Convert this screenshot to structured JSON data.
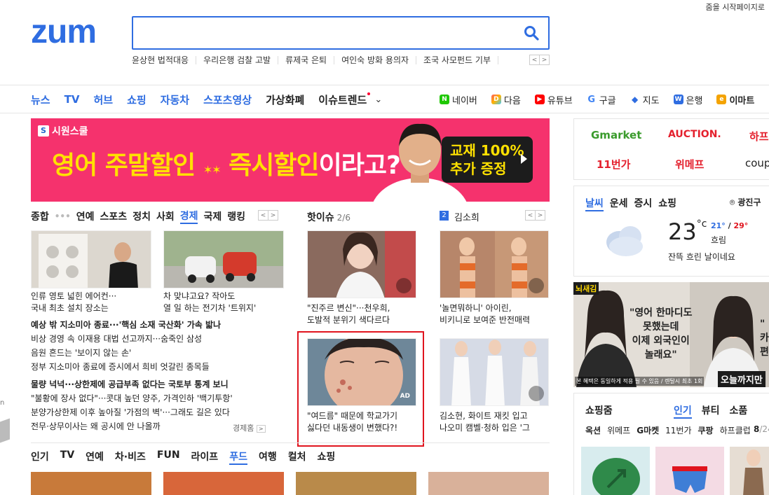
{
  "top": {
    "start_page_text": "줌을 시작페이지로"
  },
  "logo": {
    "text": "zum"
  },
  "search": {
    "value": "",
    "placeholder": ""
  },
  "trending_keywords": [
    "윤상현 법적대응",
    "우리은행 검찰 고발",
    "류제국 은퇴",
    "여인숙 방화 용의자",
    "조국 사모펀드 기부"
  ],
  "nav": {
    "items": [
      {
        "label": "뉴스",
        "style": "blue"
      },
      {
        "label": "TV",
        "style": "blue"
      },
      {
        "label": "허브",
        "style": "blue"
      },
      {
        "label": "쇼핑",
        "style": "blue"
      },
      {
        "label": "자동차",
        "style": "blue"
      },
      {
        "label": "스포츠영상",
        "style": "blue"
      },
      {
        "label": "가상화폐",
        "style": "dark"
      },
      {
        "label": "이슈트렌드",
        "style": "dark"
      }
    ],
    "shortcuts": [
      {
        "label": "네이버",
        "icon": "naver-icon",
        "color": "#1ec800",
        "glyph": "N"
      },
      {
        "label": "다음",
        "icon": "daum-icon",
        "color": "#6b8bff",
        "glyph": "D"
      },
      {
        "label": "유튜브",
        "icon": "youtube-icon",
        "color": "#ff0000",
        "glyph": "▶"
      },
      {
        "label": "구글",
        "icon": "google-icon",
        "color": "#4285f4",
        "glyph": "G"
      },
      {
        "label": "지도",
        "icon": "map-icon",
        "color": "#2f6de1",
        "glyph": "◆"
      },
      {
        "label": "은행",
        "icon": "bank-icon",
        "color": "#2f6de1",
        "glyph": "W"
      },
      {
        "label": "이마트",
        "icon": "emart-icon",
        "color": "#f4a300",
        "glyph": "e"
      }
    ]
  },
  "banner": {
    "brand": "시원스쿨",
    "headline_yellow_1": "영어 주말할인",
    "headline_mid": "즉시할인",
    "headline_white": "이라고?",
    "badge_line1": "교재 100%",
    "badge_line2": "추가 증정"
  },
  "news_tabs": {
    "items": [
      "종합",
      "연예",
      "스포츠",
      "정치",
      "사회",
      "경제",
      "국제",
      "랭킹"
    ],
    "active": "경제"
  },
  "news": {
    "thumb1_caption": [
      "인류 영토 넓힌 에어컨···",
      "국내 최초 설치 장소는"
    ],
    "thumb2_caption": [
      "차 맞냐고요? 작아도",
      "열 일 하는 전기차 '트위지'"
    ],
    "lines": [
      {
        "text": "예상 밖 지소미아 종료···'핵심 소재 국산화' 가속 밟나",
        "bold": true
      },
      {
        "text": "비상 경영 속 이재용 대법 선고까지···숨죽인 삼성",
        "bold": false
      },
      {
        "text": "음원 흔드는 '보이지 않는 손'",
        "bold": false
      },
      {
        "text": "정부 지소미아 종료에 증시에서 희비 엇갈린 종목들",
        "bold": false
      },
      {
        "text": "물량 넉넉···상한제에 공급부족 없다는 국토부 통계 보니",
        "bold": true
      },
      {
        "text": "\"불황에 장사 없다\"···콧대 높던 양주, 가격인하 '백기투항'",
        "bold": false
      },
      {
        "text": "분양가상한제 이후 높아질 '가점의 벽'···그래도 길은 있다",
        "bold": false
      },
      {
        "text": "전무·상무이사는 왜 공시에 안 나올까",
        "bold": false
      }
    ],
    "source": "경제홈"
  },
  "hot_issue": {
    "title": "핫이슈",
    "count": "2/6",
    "rank_num": "2",
    "keyword": "김소희",
    "card1_caption": [
      "\"진주르 변신\"···천우희,",
      "도발적 분위기 색다르다"
    ],
    "card2_caption": [
      "'놀면뭐하니' 아이린,",
      "비키니로 보여준 반전매력"
    ],
    "ad_caption": [
      "\"여드름\" 때문에 학교가기",
      "싫다던 내동생이 변했다?!"
    ],
    "ad_tag": "AD",
    "card4_caption": [
      "김소현, 화이트 재킷 입고",
      "나오미 캠벨·청하 입은 '그"
    ]
  },
  "bottom_tabs": {
    "items": [
      "인기",
      "TV",
      "연예",
      "차·비즈",
      "FUN",
      "라이프",
      "푸드",
      "여행",
      "컬처",
      "쇼핑"
    ],
    "active": "푸드"
  },
  "shop_links": [
    "Gmarket",
    "AUCTION.",
    "하프",
    "11번가",
    "위메프",
    "coup"
  ],
  "weather": {
    "tabs": [
      "날씨",
      "운세",
      "증시",
      "쇼핑"
    ],
    "active": "날씨",
    "location": "광진구",
    "temp": "23",
    "unit": "°c",
    "low": "21°",
    "high": "29°",
    "condition": "흐림",
    "description": "잔뜩 흐린 날이네요"
  },
  "side_ad": {
    "tag": "뇌새김",
    "quote_lines": [
      "\"영어 한마디도",
      "못했는데",
      "이제 외국인이",
      "놀래요\""
    ],
    "quote2_lines": [
      "\"",
      "카",
      "편"
    ],
    "fine": "본 혜택은 동일하게 적용 될 수 있음 / 렌탈시 최초 1회",
    "cta": "오늘까지만"
  },
  "shopping": {
    "title": "쇼핑줌",
    "tabs": [
      "인기",
      "뷰티",
      "소품"
    ],
    "active": "인기",
    "malls": [
      {
        "label": "옥션",
        "bold": true
      },
      {
        "label": "위메프",
        "bold": false
      },
      {
        "label": "G마켓",
        "bold": true
      },
      {
        "label": "11번가",
        "bold": false
      },
      {
        "label": "쿠팡",
        "bold": true
      },
      {
        "label": "하프클럽",
        "bold": false
      }
    ],
    "page": "8",
    "total": "/24"
  },
  "colors": {
    "accent": "#2f6de1",
    "banner_bg": "#f5326d",
    "ad_border": "#e0141e"
  }
}
